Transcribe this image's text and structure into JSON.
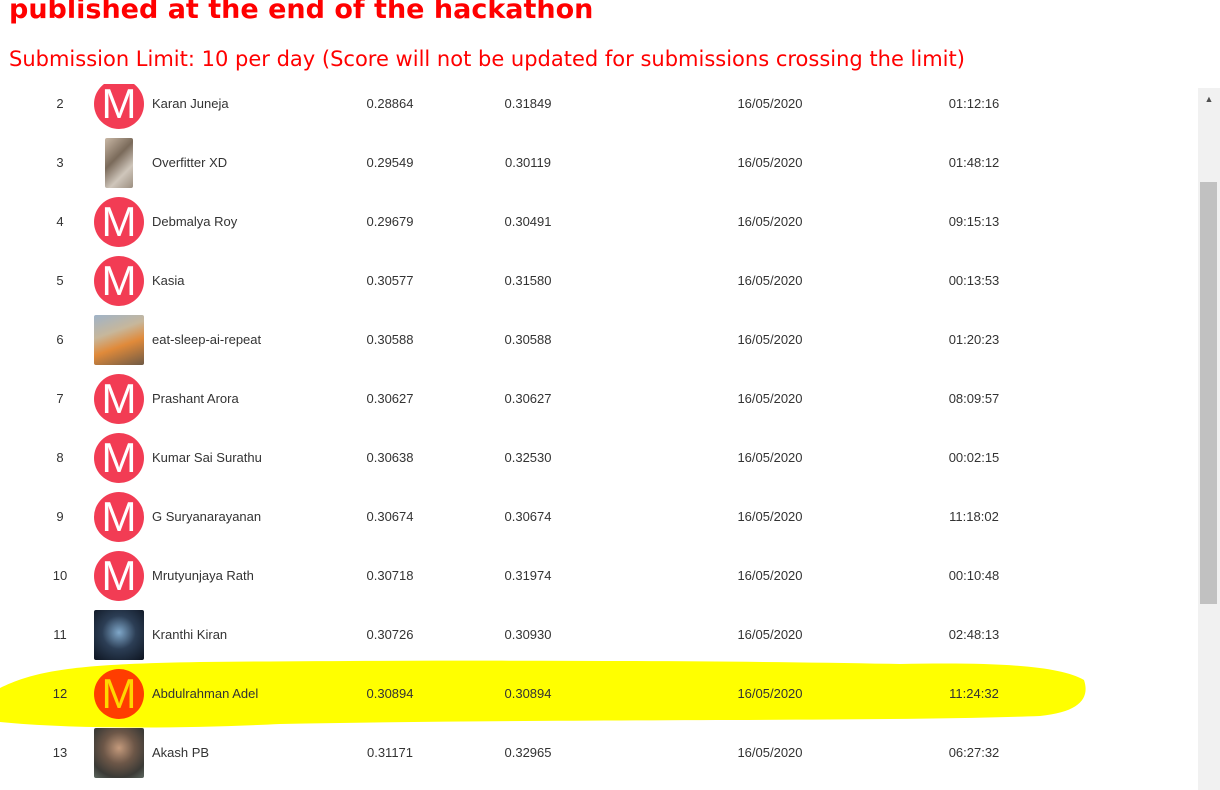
{
  "header": {
    "headline": "published at the end of the hackathon",
    "submission_limit": "Submission Limit: 10 per day (Score will not be updated for submissions crossing the limit)"
  },
  "leaderboard": {
    "rows": [
      {
        "rank": "2",
        "avatar": "m-logo",
        "name": "Karan Juneja",
        "score_public": "0.28864",
        "score_private": "0.31849",
        "date": "16/05/2020",
        "time": "01:12:16",
        "highlighted": false
      },
      {
        "rank": "3",
        "avatar": "photo",
        "name": "Overfitter XD",
        "score_public": "0.29549",
        "score_private": "0.30119",
        "date": "16/05/2020",
        "time": "01:48:12",
        "highlighted": false
      },
      {
        "rank": "4",
        "avatar": "m-logo",
        "name": "Debmalya Roy",
        "score_public": "0.29679",
        "score_private": "0.30491",
        "date": "16/05/2020",
        "time": "09:15:13",
        "highlighted": false
      },
      {
        "rank": "5",
        "avatar": "m-logo",
        "name": "Kasia",
        "score_public": "0.30577",
        "score_private": "0.31580",
        "date": "16/05/2020",
        "time": "00:13:53",
        "highlighted": false
      },
      {
        "rank": "6",
        "avatar": "photo",
        "name": "eat-sleep-ai-repeat",
        "score_public": "0.30588",
        "score_private": "0.30588",
        "date": "16/05/2020",
        "time": "01:20:23",
        "highlighted": false
      },
      {
        "rank": "7",
        "avatar": "m-logo",
        "name": "Prashant Arora",
        "score_public": "0.30627",
        "score_private": "0.30627",
        "date": "16/05/2020",
        "time": "08:09:57",
        "highlighted": false
      },
      {
        "rank": "8",
        "avatar": "m-logo",
        "name": "Kumar Sai Surathu",
        "score_public": "0.30638",
        "score_private": "0.32530",
        "date": "16/05/2020",
        "time": "00:02:15",
        "highlighted": false
      },
      {
        "rank": "9",
        "avatar": "m-logo",
        "name": "G Suryanarayanan",
        "score_public": "0.30674",
        "score_private": "0.30674",
        "date": "16/05/2020",
        "time": "11:18:02",
        "highlighted": false
      },
      {
        "rank": "10",
        "avatar": "m-logo",
        "name": "Mrutyunjaya Rath",
        "score_public": "0.30718",
        "score_private": "0.31974",
        "date": "16/05/2020",
        "time": "00:10:48",
        "highlighted": false
      },
      {
        "rank": "11",
        "avatar": "photo",
        "name": "Kranthi Kiran",
        "score_public": "0.30726",
        "score_private": "0.30930",
        "date": "16/05/2020",
        "time": "02:48:13",
        "highlighted": false
      },
      {
        "rank": "12",
        "avatar": "m-logo",
        "name": "Abdulrahman Adel",
        "score_public": "0.30894",
        "score_private": "0.30894",
        "date": "16/05/2020",
        "time": "11:24:32",
        "highlighted": true
      },
      {
        "rank": "13",
        "avatar": "photo",
        "name": "Akash PB",
        "score_public": "0.31171",
        "score_private": "0.32965",
        "date": "16/05/2020",
        "time": "06:27:32",
        "highlighted": false
      }
    ],
    "logo_letter": "M"
  },
  "colors": {
    "title_red": "#ff0000",
    "logo_red": "#f23c54",
    "highlight_yellow": "#ffff00",
    "highlight_logo_orange": "#ff3d00",
    "scroll_track": "#f1f1f1",
    "scroll_thumb": "#c1c1c1"
  },
  "icons": {
    "avatar_logo": "m-logo-icon",
    "scroll_up": "triangle-up-icon"
  }
}
